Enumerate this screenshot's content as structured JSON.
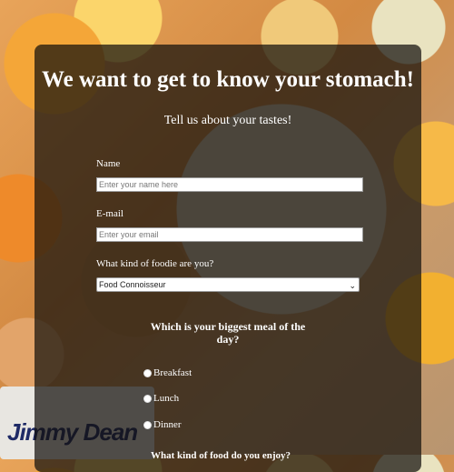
{
  "background": {
    "brand_text": "Jimmy Dean"
  },
  "form": {
    "title": "We want to get to know your stomach!",
    "subtitle": "Tell us about your tastes!",
    "name": {
      "label": "Name",
      "placeholder": "Enter your name here",
      "value": ""
    },
    "email": {
      "label": "E-mail",
      "placeholder": "Enter your email",
      "value": ""
    },
    "foodie": {
      "label": "What kind of foodie are you?",
      "selected": "Food Connoisseur"
    },
    "meal_question": "Which is your biggest meal of the day?",
    "meal_options": [
      "Breakfast",
      "Lunch",
      "Dinner"
    ],
    "next_question_partial": "What kind of food do you enjoy?"
  },
  "colors": {
    "overlay": "#14100c",
    "text": "#ffffff"
  }
}
